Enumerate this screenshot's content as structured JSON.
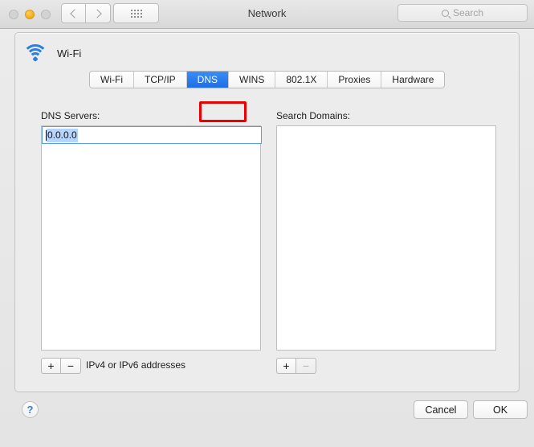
{
  "window": {
    "title": "Network",
    "traffic_lights": [
      {
        "name": "close",
        "state": "inactive"
      },
      {
        "name": "minimize",
        "state": "amber"
      },
      {
        "name": "zoom",
        "state": "inactive"
      }
    ]
  },
  "toolbar": {
    "back_icon": "chevron-left-icon",
    "forward_icon": "chevron-right-icon",
    "show_all_icon": "grid-dots-icon",
    "search": {
      "placeholder": "Search",
      "value": "",
      "icon": "search-icon"
    }
  },
  "service": {
    "name": "Wi-Fi",
    "icon": "wifi-icon"
  },
  "tabs": [
    {
      "label": "Wi-Fi",
      "selected": false
    },
    {
      "label": "TCP/IP",
      "selected": false
    },
    {
      "label": "DNS",
      "selected": true
    },
    {
      "label": "WINS",
      "selected": false
    },
    {
      "label": "802.1X",
      "selected": false
    },
    {
      "label": "Proxies",
      "selected": false
    },
    {
      "label": "Hardware",
      "selected": false
    }
  ],
  "annotation": {
    "target": "DNS",
    "color": "#ea0000"
  },
  "dns_servers": {
    "label": "DNS Servers:",
    "entries": [
      "0.0.0.0"
    ],
    "selected_entry": "0.0.0.0",
    "hint": "IPv4 or IPv6 addresses",
    "add_label": "+",
    "remove_label": "−",
    "add_enabled": true,
    "remove_enabled": true
  },
  "search_domains": {
    "label": "Search Domains:",
    "entries": [],
    "add_label": "+",
    "remove_label": "−",
    "add_enabled": true,
    "remove_enabled": false
  },
  "footer": {
    "help_label": "?",
    "cancel_label": "Cancel",
    "ok_label": "OK"
  },
  "colors": {
    "tab_selected": "#2f7fe8",
    "annotation": "#ea0000",
    "selection": "#b4d5fe",
    "accent": "#2b7fe0"
  }
}
